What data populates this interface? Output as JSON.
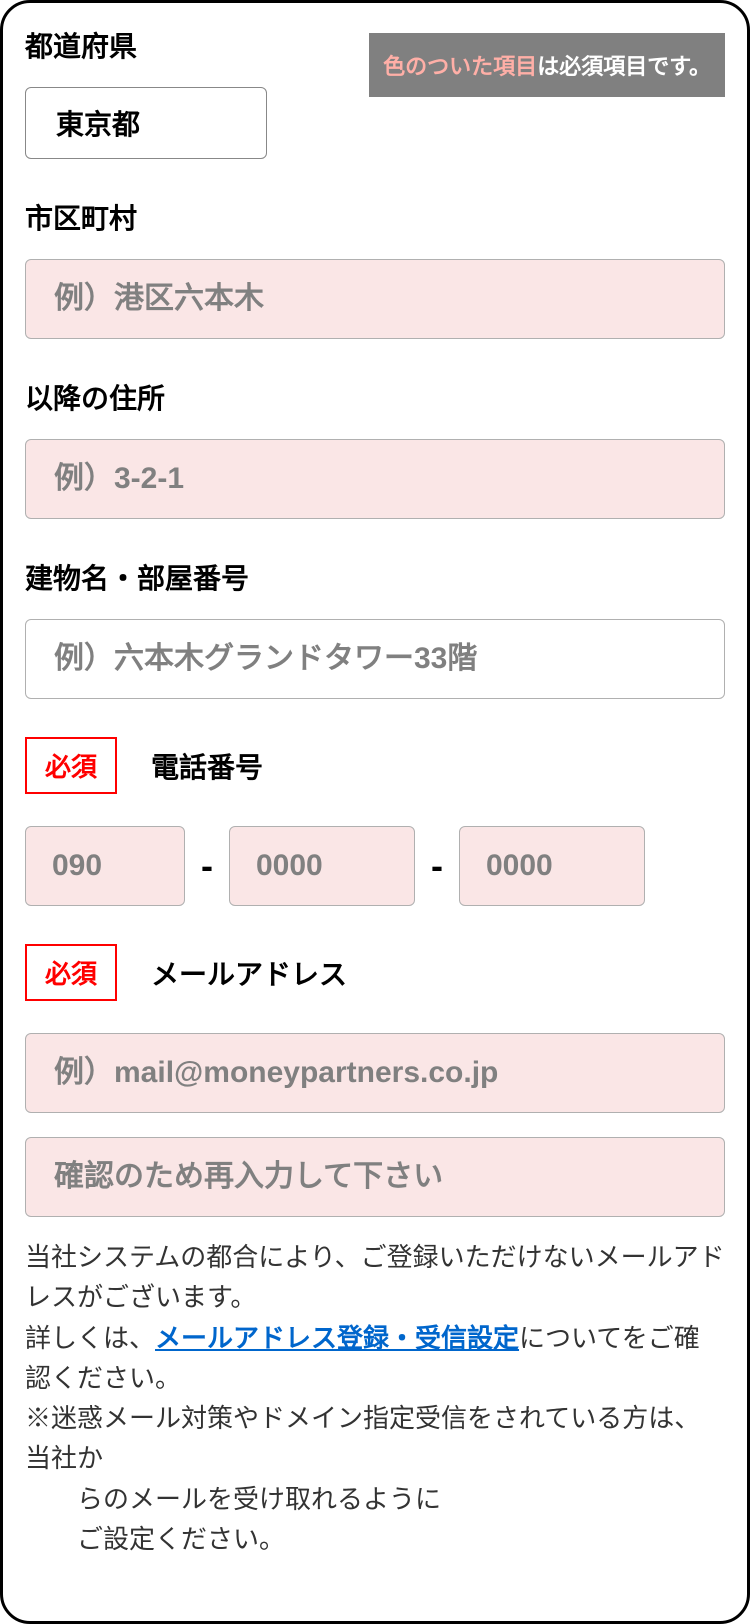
{
  "notice": {
    "highlight": "色のついた項目",
    "rest": "は必須項目です。"
  },
  "required_badge": "必須",
  "fields": {
    "prefecture": {
      "label": "都道府県",
      "value": "東京都"
    },
    "city": {
      "label": "市区町村",
      "placeholder": "例）港区六本木"
    },
    "address2": {
      "label": "以降の住所",
      "placeholder": "例）3-2-1"
    },
    "building": {
      "label": "建物名・部屋番号",
      "placeholder": "例）六本木グランドタワー33階"
    },
    "phone": {
      "label": "電話番号",
      "p1": "090",
      "p2": "0000",
      "p3": "0000",
      "dash": "-"
    },
    "email": {
      "label": "メールアドレス",
      "placeholder": "例）mail@moneypartners.co.jp",
      "confirm_placeholder": "確認のため再入力して下さい"
    }
  },
  "notes": {
    "line1": "当社システムの都合により、ご登録いただけないメールアドレスがございます。",
    "line2_pre": "詳しくは、",
    "line2_link": "メールアドレス登録・受信設定",
    "line2_post": "についてをご確認ください。",
    "line3": "※迷惑メール対策やドメイン指定受信をされている方は、当社か",
    "line3b": "らのメールを受け取れるように",
    "line3c": "ご設定ください。"
  }
}
